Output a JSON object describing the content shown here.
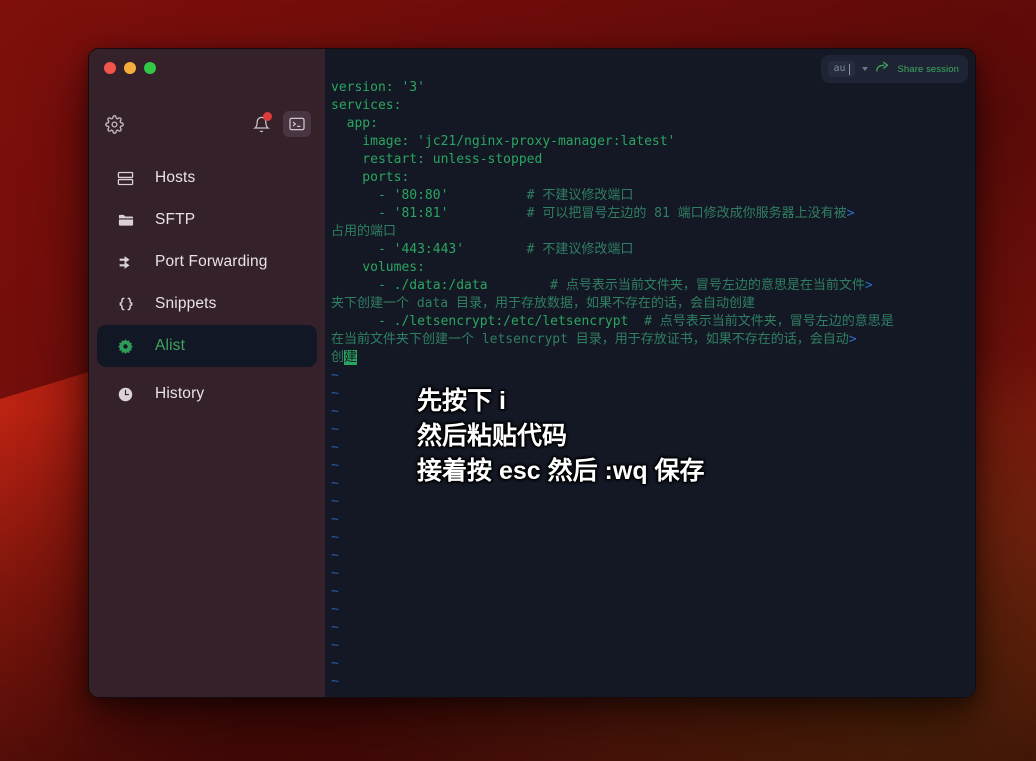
{
  "window": {
    "traffic_lights": [
      "close",
      "minimize",
      "maximize"
    ]
  },
  "sidebar": {
    "toolbar": {
      "settings_icon": "gear-icon",
      "notifications_icon": "bell-icon",
      "notifications_badge": "",
      "terminal_icon": "terminal-icon"
    },
    "items": [
      {
        "label": "Hosts",
        "icon": "server-icon",
        "selected": false
      },
      {
        "label": "SFTP",
        "icon": "folder-icon",
        "selected": false
      },
      {
        "label": "Port Forwarding",
        "icon": "arrow-fork-icon",
        "selected": false
      },
      {
        "label": "Snippets",
        "icon": "braces-icon",
        "selected": false
      },
      {
        "label": "Alist",
        "icon": "gear-flower-icon",
        "selected": true
      },
      {
        "label": "History",
        "icon": "clock-icon",
        "selected": false
      }
    ]
  },
  "terminal": {
    "share_bar": {
      "session_name": "au",
      "caret_icon": "chevron-down-icon",
      "share_icon": "share-arrow-icon",
      "share_label": "Share session"
    },
    "lines": [
      [
        {
          "t": "version: '3'",
          "c": "code"
        }
      ],
      [
        {
          "t": "services:",
          "c": "code"
        }
      ],
      [
        {
          "t": "  app:",
          "c": "code"
        }
      ],
      [
        {
          "t": "    image: 'jc21/nginx-proxy-manager:latest'",
          "c": "code"
        }
      ],
      [
        {
          "t": "    restart: unless-stopped",
          "c": "code"
        }
      ],
      [
        {
          "t": "    ports:",
          "c": "code"
        }
      ],
      [
        {
          "t": "      - '80:80'",
          "c": "code"
        },
        {
          "t": "          # 不建议修改端口",
          "c": "comment"
        }
      ],
      [
        {
          "t": "      - '81:81'",
          "c": "code"
        },
        {
          "t": "          # 可以把冒号左边的 81 端口修改成你服务器上没有被",
          "c": "comment"
        },
        {
          "t": ">",
          "c": "wrap"
        }
      ],
      [
        {
          "t": "占用的端口",
          "c": "comment"
        }
      ],
      [
        {
          "t": "      - '443:443'",
          "c": "code"
        },
        {
          "t": "        # 不建议修改端口",
          "c": "comment"
        }
      ],
      [
        {
          "t": "    volumes:",
          "c": "code"
        }
      ],
      [
        {
          "t": "      - ./data:/data",
          "c": "code"
        },
        {
          "t": "        # 点号表示当前文件夹，冒号左边的意思是在当前文件",
          "c": "comment"
        },
        {
          "t": ">",
          "c": "wrap"
        }
      ],
      [
        {
          "t": "夹下创建一个 data 目录，用于存放数据，如果不存在的话，会自动创建",
          "c": "comment"
        }
      ],
      [
        {
          "t": "      - ./letsencrypt:/etc/letsencrypt",
          "c": "code"
        },
        {
          "t": "  # 点号表示当前文件夹，冒号左边的意思是",
          "c": "comment"
        }
      ],
      [
        {
          "t": "在当前文件夹下创建一个 letsencrypt 目录，用于存放证书，如果不存在的话，会自动",
          "c": "comment"
        },
        {
          "t": ">",
          "c": "wrap"
        }
      ],
      [
        {
          "t": "创",
          "c": "comment"
        },
        {
          "t": "建",
          "c": "cursor"
        }
      ],
      [
        {
          "t": "~",
          "c": "tilde"
        }
      ],
      [
        {
          "t": "~",
          "c": "tilde"
        }
      ],
      [
        {
          "t": "~",
          "c": "tilde"
        }
      ],
      [
        {
          "t": "~",
          "c": "tilde"
        }
      ],
      [
        {
          "t": "~",
          "c": "tilde"
        }
      ],
      [
        {
          "t": "~",
          "c": "tilde"
        }
      ],
      [
        {
          "t": "~",
          "c": "tilde"
        }
      ],
      [
        {
          "t": "~",
          "c": "tilde"
        }
      ],
      [
        {
          "t": "~",
          "c": "tilde"
        }
      ],
      [
        {
          "t": "~",
          "c": "tilde"
        }
      ],
      [
        {
          "t": "~",
          "c": "tilde"
        }
      ],
      [
        {
          "t": "~",
          "c": "tilde"
        }
      ],
      [
        {
          "t": "~",
          "c": "tilde"
        }
      ],
      [
        {
          "t": "~",
          "c": "tilde"
        }
      ],
      [
        {
          "t": "~",
          "c": "tilde"
        }
      ],
      [
        {
          "t": "~",
          "c": "tilde"
        }
      ],
      [
        {
          "t": "~",
          "c": "tilde"
        }
      ],
      [
        {
          "t": "~",
          "c": "tilde"
        }
      ]
    ]
  },
  "caption": {
    "lines": [
      "先按下 i",
      "然后粘贴代码",
      "接着按 esc 然后 :wq 保存"
    ]
  },
  "colors": {
    "terminal_bg": "#141824",
    "sidebar_bg": "#34212a",
    "code_green": "#2aa561",
    "comment_green": "#2f7f63",
    "tilde_blue": "#2a5fa8",
    "accent_green": "#3fa45c",
    "badge_red": "#ef3e3e"
  }
}
